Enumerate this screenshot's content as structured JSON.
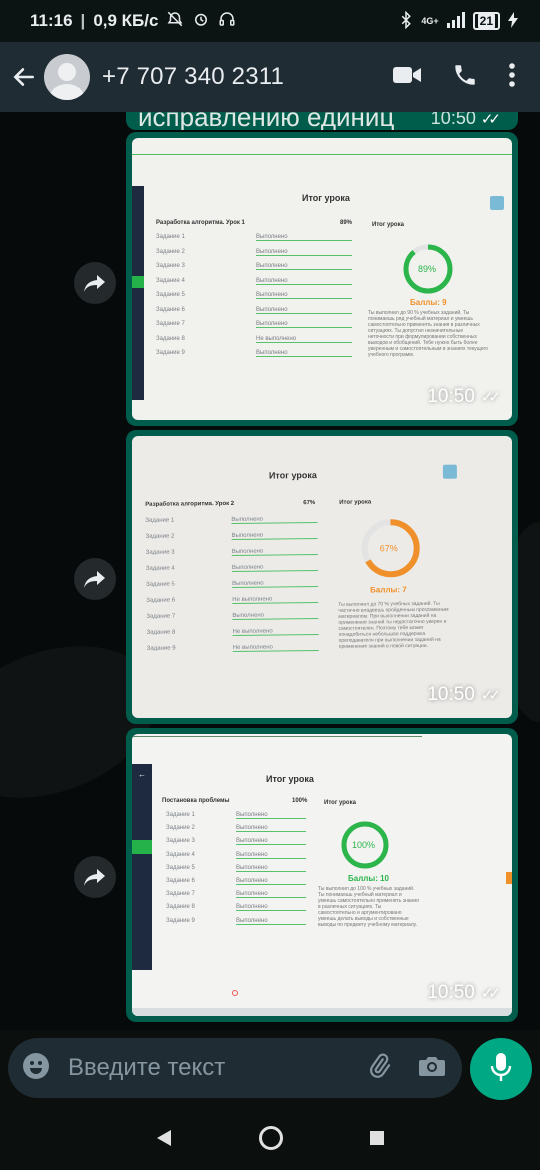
{
  "status_bar": {
    "time": "11:16",
    "network_speed": "0,9 КБ/с",
    "network_type": "4G+",
    "battery": "21",
    "icons": [
      "alarm-off-icon",
      "alarm-clock-icon",
      "headset-icon",
      "bluetooth-icon",
      "signal-icon",
      "battery-icon",
      "charging-icon"
    ]
  },
  "header": {
    "contact": "+7 707 340 2311",
    "icons": [
      "back-arrow-icon",
      "avatar-icon",
      "video-call-icon",
      "phone-call-icon",
      "more-vert-icon"
    ]
  },
  "chat": {
    "previous_message": {
      "text": "исправлению единиц",
      "time": "10:50"
    },
    "messages": [
      {
        "time": "10:50",
        "photo": {
          "title": "Итог урока",
          "subtitle": "Разработка алгоритма. Урок 1",
          "percent_label": "89%",
          "summary_label": "Итог урока",
          "ring_value": "89%",
          "ring_fraction": 0.89,
          "score": "Баллы: 9",
          "accent": "#2bb54a",
          "tasks": [
            {
              "name": "Задание 1",
              "status": "Выполнено"
            },
            {
              "name": "Задание 2",
              "status": "Выполнено"
            },
            {
              "name": "Задание 3",
              "status": "Выполнено"
            },
            {
              "name": "Задание 4",
              "status": "Выполнено"
            },
            {
              "name": "Задание 5",
              "status": "Выполнено"
            },
            {
              "name": "Задание 6",
              "status": "Выполнено"
            },
            {
              "name": "Задание 7",
              "status": "Выполнено"
            },
            {
              "name": "Задание 8",
              "status": "Не выполнено"
            },
            {
              "name": "Задание 9",
              "status": "Выполнено"
            }
          ],
          "description": "Ты выполнил до 90 % учебных заданий. Ты понимаешь ряд учебный материал и умеешь самостоятельно применять знания в различных ситуациях. Ты допустил незначительные неточности при формулировании собственных выводов и обобщений. Тебе нужно быть более уверенным и самостоятельным в знаниях текущего учебного программ."
        }
      },
      {
        "time": "10:50",
        "photo": {
          "title": "Итог урока",
          "subtitle": "Разработка алгоритма. Урок 2",
          "percent_label": "67%",
          "summary_label": "Итог урока",
          "ring_value": "67%",
          "ring_fraction": 0.67,
          "score": "Баллы: 7",
          "accent": "#f0902a",
          "tasks": [
            {
              "name": "Задание 1",
              "status": "Выполнено"
            },
            {
              "name": "Задание 2",
              "status": "Выполнено"
            },
            {
              "name": "Задание 3",
              "status": "Выполнено"
            },
            {
              "name": "Задание 4",
              "status": "Выполнено"
            },
            {
              "name": "Задание 5",
              "status": "Выполнено"
            },
            {
              "name": "Задание 6",
              "status": "Не выполнено"
            },
            {
              "name": "Задание 7",
              "status": "Выполнено"
            },
            {
              "name": "Задание 8",
              "status": "Не выполнено"
            },
            {
              "name": "Задание 9",
              "status": "Не выполнено"
            }
          ],
          "description": "Ты выполнил до 70 % учебных заданий. Ты частично владеешь пройденным программным материалом. При выполнении заданий на применение знаний ты недостаточно уверен и самостоятелен. Поэтому тебе может понадобиться небольшая поддержка преподавателя при выполнении заданий на применение знаний в новой ситуации."
        }
      },
      {
        "time": "10:50",
        "photo": {
          "title": "Итог урока",
          "subtitle": "Постановка проблемы",
          "percent_label": "100%",
          "summary_label": "Итог урока",
          "ring_value": "100%",
          "ring_fraction": 1.0,
          "score": "Баллы: 10",
          "accent": "#2bb54a",
          "tasks": [
            {
              "name": "Задание 1",
              "status": "Выполнено"
            },
            {
              "name": "Задание 2",
              "status": "Выполнено"
            },
            {
              "name": "Задание 3",
              "status": "Выполнено"
            },
            {
              "name": "Задание 4",
              "status": "Выполнено"
            },
            {
              "name": "Задание 5",
              "status": "Выполнено"
            },
            {
              "name": "Задание 6",
              "status": "Выполнено"
            },
            {
              "name": "Задание 7",
              "status": "Выполнено"
            },
            {
              "name": "Задание 8",
              "status": "Выполнено"
            },
            {
              "name": "Задание 9",
              "status": "Выполнено"
            }
          ],
          "description": "Ты выполнил до 100 % учебных заданий. Ты понимаешь учебный материал и умеешь самостоятельно применять знания в различных ситуациях. Ты самостоятельно и аргументировано умеешь делать выводы и собственные выводы по предмету учебному материалу."
        }
      }
    ]
  },
  "input": {
    "placeholder": "Введите текст",
    "icons": [
      "emoji-icon",
      "attach-icon",
      "camera-icon",
      "mic-icon"
    ]
  },
  "nav": {
    "icons": [
      "nav-back-icon",
      "nav-home-icon",
      "nav-recents-icon"
    ]
  },
  "colors": {
    "header_bg": "#1f2c34",
    "bubble_out": "#005c4b",
    "accent": "#00a884"
  }
}
